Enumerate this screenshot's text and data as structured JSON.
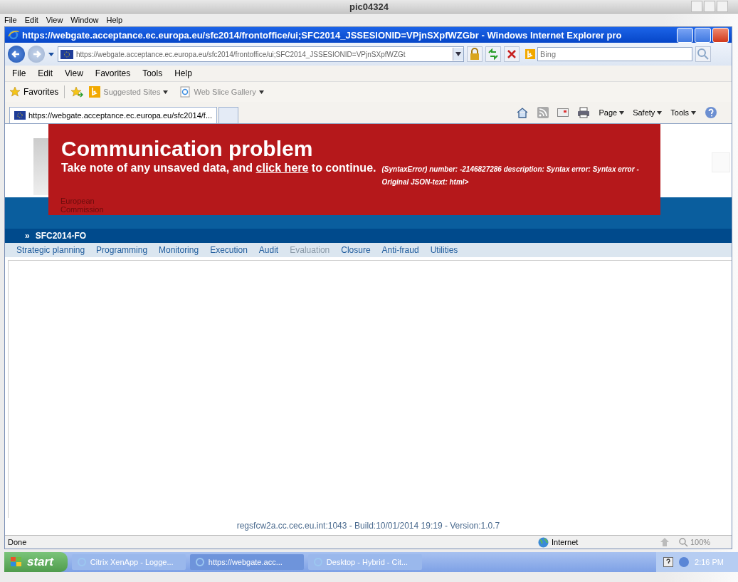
{
  "outer_window": {
    "title": "pic04324",
    "menu": [
      "File",
      "Edit",
      "View",
      "Window",
      "Help"
    ]
  },
  "browser": {
    "title": "https://webgate.acceptance.ec.europa.eu/sfc2014/frontoffice/ui;SFC2014_JSSESIONID=VPjnSXpfWZGbr - Windows Internet Explorer pro",
    "address": "https://webgate.acceptance.ec.europa.eu/sfc2014/frontoffice/ui;SFC2014_JSSESIONID=VPjnSXpfWZGt",
    "search_placeholder": "Bing",
    "menu": [
      "File",
      "Edit",
      "View",
      "Favorites",
      "Tools",
      "Help"
    ],
    "favorites": {
      "label": "Favorites",
      "links": [
        "Suggested Sites",
        "Web Slice Gallery"
      ]
    },
    "tabs": [
      {
        "label": "https://webgate.acceptance.ec.europa.eu/sfc2014/f...",
        "selected": true
      }
    ],
    "commands": [
      "Page",
      "Safety",
      "Tools"
    ]
  },
  "page": {
    "logo_text": "European Commission",
    "breadcrumb_marker": "»",
    "app_name": "SFC2014-FO",
    "nav": [
      {
        "label": "Strategic planning",
        "disabled": false
      },
      {
        "label": "Programming",
        "disabled": false
      },
      {
        "label": "Monitoring",
        "disabled": false
      },
      {
        "label": "Execution",
        "disabled": false
      },
      {
        "label": "Audit",
        "disabled": false
      },
      {
        "label": "Evaluation",
        "disabled": true
      },
      {
        "label": "Closure",
        "disabled": false
      },
      {
        "label": "Anti-fraud",
        "disabled": false
      },
      {
        "label": "Utilities",
        "disabled": false
      }
    ],
    "footer": "regsfcw2a.cc.cec.eu.int:1043 - Build:10/01/2014 19:19 - Version:1.0.7"
  },
  "error_banner": {
    "title": "Communication problem",
    "message_before": "Take note of any unsaved data, and",
    "link": "click here",
    "message_after": "to continue.",
    "detail": "(SyntaxError) number: -2146827286 description: Syntax error: Syntax error - Original JSON-text: html>"
  },
  "status_bar": {
    "status": "Done",
    "zone": "Internet",
    "zoom": "100%"
  },
  "taskbar": {
    "start": "start",
    "items": [
      {
        "label": "Citrix XenApp - Logge...",
        "selected": false
      },
      {
        "label": "https://webgate.acc...",
        "selected": true
      },
      {
        "label": "Desktop - Hybrid - Cit...",
        "selected": false
      }
    ],
    "clock": "2:16 PM"
  }
}
